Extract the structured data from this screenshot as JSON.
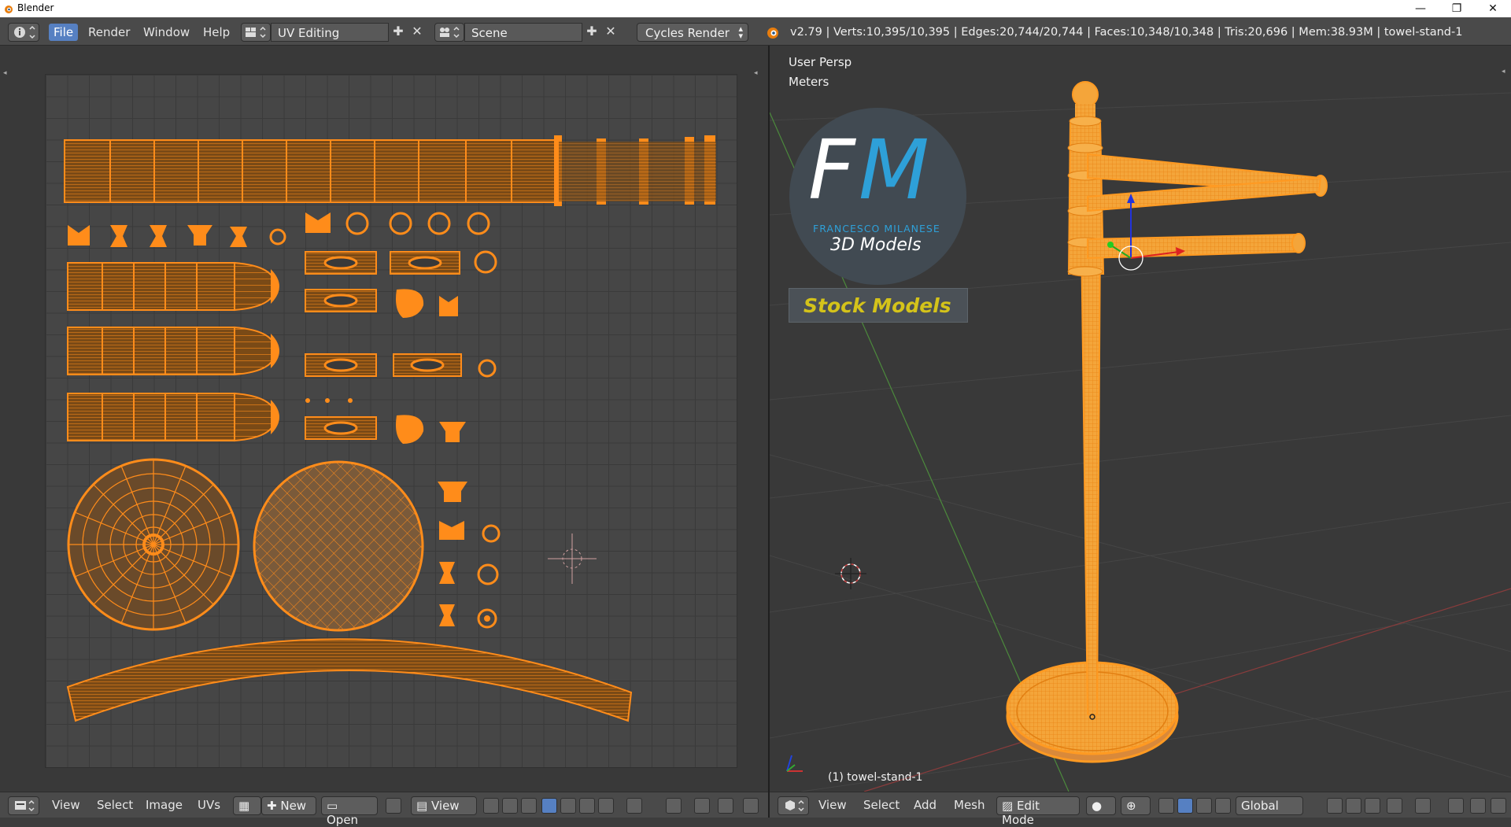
{
  "window": {
    "title": "Blender"
  },
  "menu": {
    "file": "File",
    "render": "Render",
    "window": "Window",
    "help": "Help"
  },
  "screen_layout": "UV Editing",
  "scene": "Scene",
  "render_engine": "Cycles Render",
  "stats": "v2.79 | Verts:10,395/10,395 | Edges:20,744/20,744 | Faces:10,348/10,348 | Tris:20,696 | Mem:38.93M | towel-stand-1",
  "viewport": {
    "persp_label": "User Persp",
    "units_label": "Meters",
    "object_label": "(1) towel-stand-1"
  },
  "logo": {
    "letters_f": "F",
    "letters_m": "M",
    "name": "FRANCESCO MILANESE",
    "subtitle": "3D Models",
    "badge": "Stock Models"
  },
  "uv_header": {
    "view": "View",
    "select": "Select",
    "image": "Image",
    "uvs": "UVs",
    "new": "New",
    "open": "Open",
    "view2": "View"
  },
  "view3d_header": {
    "view": "View",
    "select": "Select",
    "add": "Add",
    "mesh": "Mesh",
    "mode": "Edit Mode",
    "orientation": "Global"
  },
  "colors": {
    "accent": "#5680c2",
    "mesh_orange": "#f28c1e",
    "mesh_edge": "#ffa033",
    "badge_text": "#d4c31a",
    "logo_f": "#ffffff",
    "logo_m": "#2ea0d8"
  },
  "icons": [
    "blender-logo-icon",
    "info-editor-icon",
    "screen-layout-icon",
    "add-icon",
    "close-icon",
    "scene-icon",
    "cycles-icon",
    "uv-editor-icon",
    "view3d-editor-icon",
    "pin-icon",
    "cube-icon",
    "sphere-icon",
    "manipulator-icon",
    "magnet-icon",
    "proportional-icon"
  ]
}
